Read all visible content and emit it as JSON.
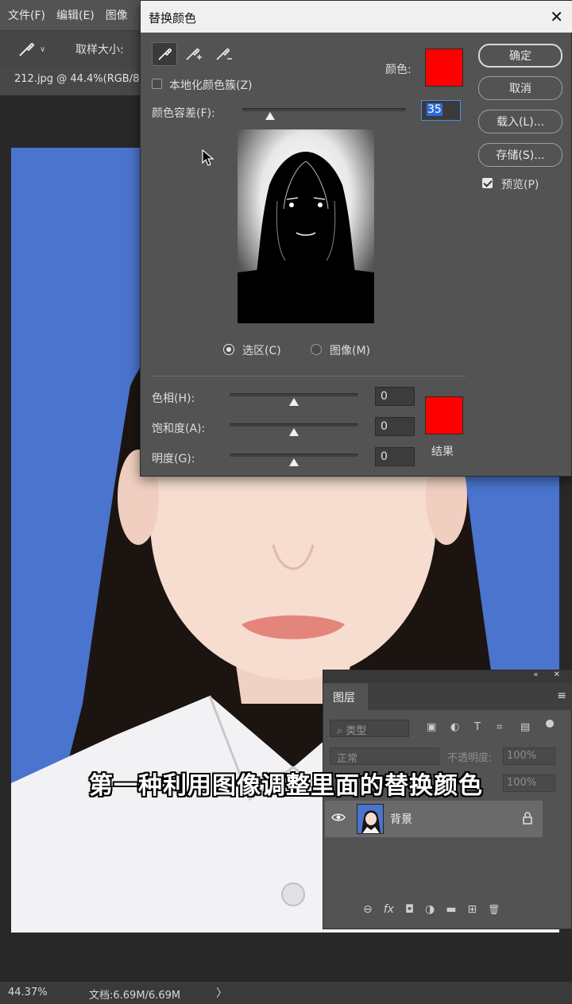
{
  "app": {
    "menu": [
      "文件(F)",
      "编辑(E)",
      "图像"
    ],
    "options": {
      "sample_size_label": "取样大小:"
    },
    "tab_title": "212.jpg @ 44.4%(RGB/8",
    "status": {
      "zoom": "44.37%",
      "doc": "文档:6.69M/6.69M",
      "arrow": "〉"
    }
  },
  "dialog": {
    "title": "替换颜色",
    "close": "✕",
    "tools": [
      "eyedropper-icon",
      "eyedropper-plus-icon",
      "eyedropper-minus-icon"
    ],
    "localized_clusters": {
      "label": "本地化颜色簇(Z)",
      "checked": false
    },
    "color_label": "颜色:",
    "color_value": "#ff0000",
    "fuzziness": {
      "label": "颜色容差(F):",
      "value": "35"
    },
    "view": {
      "selection": "选区(C)",
      "image": "图像(M)",
      "selected": "selection"
    },
    "replacement": {
      "hue": {
        "label": "色相(H):",
        "value": "0"
      },
      "saturation": {
        "label": "饱和度(A):",
        "value": "0"
      },
      "lightness": {
        "label": "明度(G):",
        "value": "0"
      },
      "result_label": "结果",
      "result_color": "#ff0000"
    },
    "buttons": {
      "ok": "确定",
      "cancel": "取消",
      "load": "载入(L)...",
      "save": "存储(S)..."
    },
    "preview": {
      "label": "预览(P)",
      "checked": true
    }
  },
  "layers_panel": {
    "tab": "图层",
    "filter_placeholder": "类型",
    "filter_icons": [
      "▣",
      "◐",
      "T",
      "⌗",
      "▤"
    ],
    "blend_mode": "正常",
    "opacity_label": "不透明度:",
    "opacity_value": "100%",
    "fill_value": "100%",
    "layers": [
      {
        "name": "背景",
        "locked": true,
        "visible": true
      }
    ],
    "footer_icons": [
      "⊖",
      "fx",
      "◘",
      "◑",
      "▬",
      "⊞",
      "🗑"
    ]
  },
  "subtitle": "第一种利用图像调整里面的替换颜色",
  "colors": {
    "background_blue": "#4a74cd",
    "accent_red": "#ff0000"
  }
}
